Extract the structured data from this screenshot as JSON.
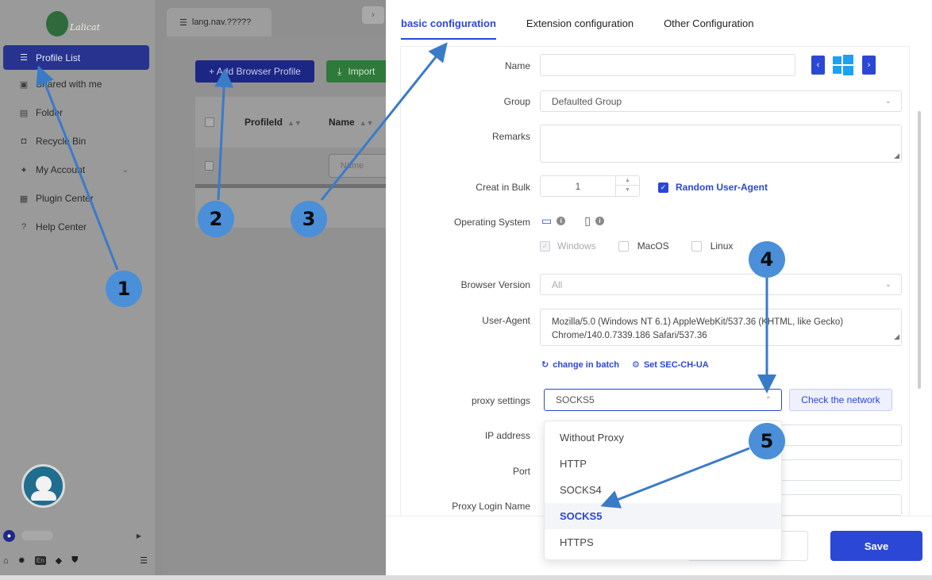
{
  "sidebar": {
    "logo_text": "Lalicat",
    "items": [
      {
        "label": "Profile List",
        "icon": "list-icon",
        "glyph": "☰"
      },
      {
        "label": "Shared with me",
        "icon": "share-icon",
        "glyph": "▣"
      },
      {
        "label": "Folder",
        "icon": "folder-icon",
        "glyph": "▤"
      },
      {
        "label": "Recycle Bin",
        "icon": "trash-icon",
        "glyph": "◘"
      },
      {
        "label": "My Account",
        "icon": "user-gear-icon",
        "glyph": "✦"
      },
      {
        "label": "Plugin Center",
        "icon": "plugin-icon",
        "glyph": "▦"
      },
      {
        "label": "Help Center",
        "icon": "help-icon",
        "glyph": "?"
      }
    ],
    "account_chevron": "⌄",
    "lang_badge": "En"
  },
  "tabs": {
    "main_tab": "lang.nav.?????"
  },
  "toolbar": {
    "add_label": "+ Add Browser Profile",
    "import_label": "Import"
  },
  "table": {
    "headers": [
      "ProfileId",
      "Name"
    ],
    "filter_placeholder": "Name"
  },
  "drawer": {
    "tabs": [
      "basic configuration",
      "Extension configuration",
      "Other Configuration"
    ],
    "labels": {
      "name": "Name",
      "group": "Group",
      "remarks": "Remarks",
      "bulk": "Creat in Bulk",
      "os": "Operating System",
      "browser_version": "Browser Version",
      "user_agent": "User-Agent",
      "proxy": "proxy settings",
      "ip": "IP address",
      "port": "Port",
      "proxy_login": "Proxy Login Name"
    },
    "values": {
      "group": "Defaulted Group",
      "bulk": "1",
      "browser_version": "All",
      "user_agent": "Mozilla/5.0 (Windows NT 6.1) AppleWebKit/537.36 (KHTML, like Gecko) Chrome/140.0.7339.186 Safari/537.36",
      "proxy": "SOCKS5"
    },
    "random_ua": "Random User-Agent",
    "os_options": [
      "Windows",
      "MacOS",
      "Linux"
    ],
    "links": {
      "change_batch": "change in batch",
      "sec_ch_ua": "Set SEC-CH-UA"
    },
    "check_network": "Check the network",
    "proxy_options": [
      "Without Proxy",
      "HTTP",
      "SOCKS4",
      "SOCKS5",
      "HTTPS"
    ],
    "save": "Save"
  },
  "annotations": [
    "1",
    "2",
    "3",
    "4",
    "5"
  ],
  "colors": {
    "accent": "#2b47d6",
    "marker": "#4a8fd8",
    "arrow": "#3a7bc8"
  }
}
